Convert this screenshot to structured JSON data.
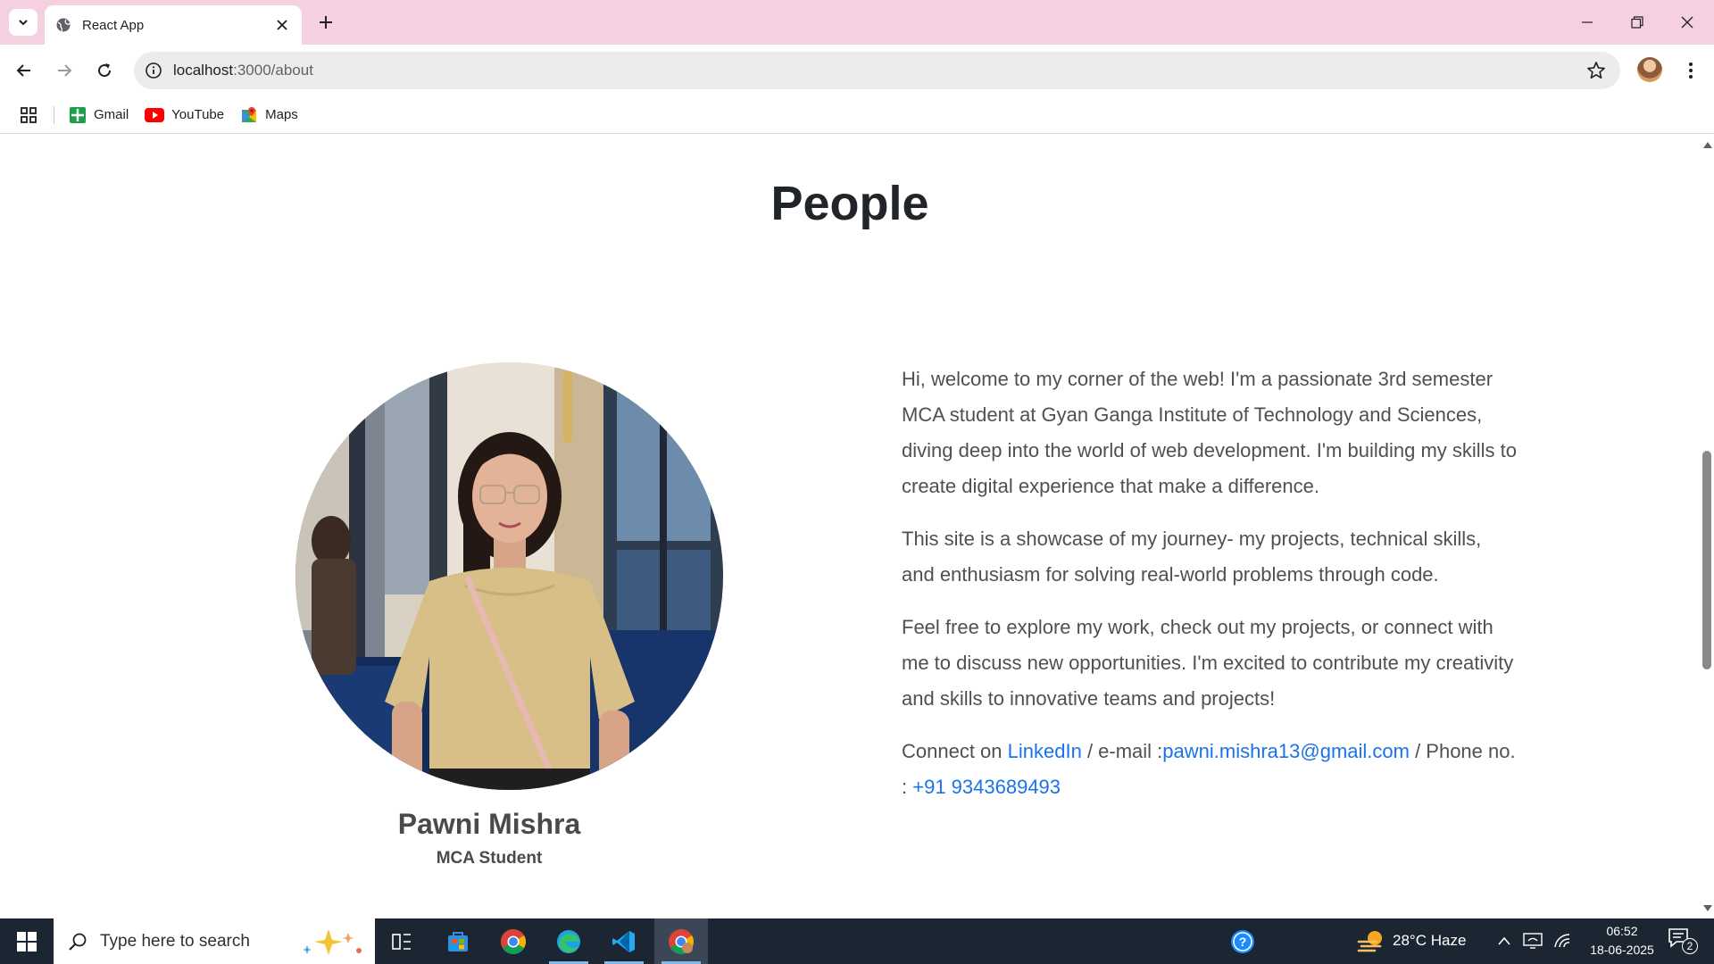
{
  "browser": {
    "tab_title": "React App",
    "url_host": "localhost",
    "url_path": ":3000/about"
  },
  "bookmarks": [
    {
      "label": "Gmail",
      "icon": "gmail-icon"
    },
    {
      "label": "YouTube",
      "icon": "youtube-icon"
    },
    {
      "label": "Maps",
      "icon": "maps-icon"
    }
  ],
  "page": {
    "heading": "People",
    "profile": {
      "name": "Pawni Mishra",
      "role": "MCA Student"
    },
    "about": {
      "p1": "Hi, welcome to my corner of the web! I'm a passionate 3rd semester MCA student at Gyan Ganga Institute of Technology and Sciences, diving deep into the world of web development. I'm building my skills to create digital experience that make a difference.",
      "p2": "This site is a showcase of my journey- my projects, technical skills, and enthusiasm for solving real-world problems through code.",
      "p3": "Feel free to explore my work, check out my projects, or connect with me to discuss new opportunities. I'm excited to contribute my creativity and skills to innovative teams and projects!",
      "connect_prefix": "Connect on ",
      "linkedin_label": "LinkedIn",
      "email_prefix": " / e-mail :",
      "email": "pawni.mishra13@gmail.com",
      "phone_prefix": " / Phone no. : ",
      "phone": "+91 9343689493"
    }
  },
  "taskbar": {
    "search_placeholder": "Type here to search",
    "weather": "28°C  Haze",
    "time": "06:52",
    "date": "18-06-2025",
    "notification_count": "2"
  },
  "colors": {
    "tabstrip": "#f5d0e1",
    "link": "#1a73e8",
    "taskbar": "#1c2633"
  }
}
